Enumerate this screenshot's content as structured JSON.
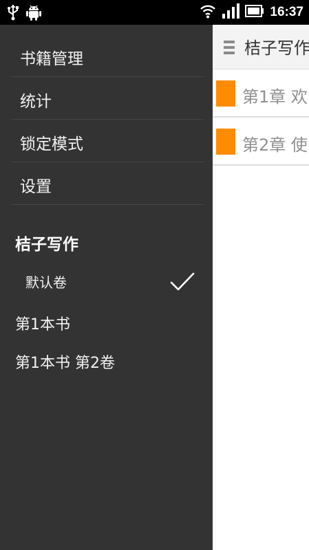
{
  "status_bar": {
    "time": "16:37",
    "icons": [
      "usb-icon",
      "android-icon",
      "wifi-icon",
      "signal-icon",
      "battery-icon"
    ]
  },
  "app_bar": {
    "menu_icon": "hamburger-icon",
    "title": "桔子写作"
  },
  "chapters": [
    {
      "title": "第1章 欢"
    },
    {
      "title": "第2章 使"
    }
  ],
  "drawer": {
    "menu": [
      {
        "label": "书籍管理"
      },
      {
        "label": "统计"
      },
      {
        "label": "锁定模式"
      },
      {
        "label": "设置"
      }
    ],
    "section_title": "桔子写作",
    "selected_volume": {
      "label": "默认卷",
      "icon": "checkmark-icon"
    },
    "books": [
      {
        "label": "第1本书"
      },
      {
        "label": "第1本书 第2卷"
      }
    ]
  },
  "colors": {
    "drawer_bg": "#333333",
    "accent_orange": "#ff8c00",
    "status_bar_bg": "#000000",
    "app_bar_bg": "#f3f3f3"
  }
}
